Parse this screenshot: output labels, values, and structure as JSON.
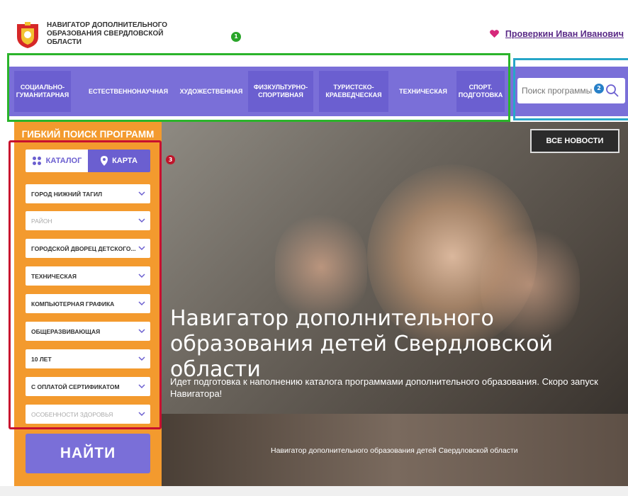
{
  "header": {
    "logo_text": "НАВИГАТОР ДОПОЛНИТЕЛЬНОГО ОБРАЗОВАНИЯ СВЕРДЛОВСКОЙ ОБЛАСТИ",
    "user_name": "Проверкин Иван Иванович",
    "markers": [
      "1",
      "2",
      "3"
    ]
  },
  "nav": {
    "items": [
      "СОЦИАЛЬНО-ГУМАНИТАРНАЯ",
      "ЕСТЕСТВЕННОНАУЧНАЯ",
      "ХУДОЖЕСТВЕННАЯ",
      "ФИЗКУЛЬТУРНО-СПОРТИВНАЯ",
      "ТУРИСТСКО-КРАЕВЕДЧЕСКАЯ",
      "ТЕХНИЧЕСКАЯ",
      "СПОРТ. ПОДГОТОВКА"
    ]
  },
  "search": {
    "placeholder": "Поиск программы"
  },
  "sidebar": {
    "title": "ГИБКИЙ ПОИСК ПРОГРАММ",
    "tabs": [
      "КАТАЛОГ",
      "КАРТА"
    ],
    "filters": [
      "ГОРОД НИЖНИЙ ТАГИЛ",
      "РАЙОН",
      "ГОРОДСКОЙ ДВОРЕЦ ДЕТСКОГО...",
      "ТЕХНИЧЕСКАЯ",
      "КОМПЬЮТЕРНАЯ ГРАФИКА",
      "ОБЩЕРАЗВИВАЮЩАЯ",
      "10 ЛЕТ",
      "С ОПЛАТОЙ СЕРТИФИКАТОМ",
      "ОСОБЕННОСТИ ЗДОРОВЬЯ"
    ],
    "find_label": "НАЙТИ"
  },
  "hero": {
    "news_button": "ВСЕ НОВОСТИ",
    "title": "Навигатор дополнительного образования детей Свердловской области",
    "subtitle": "Идет подготовка к наполнению каталога программами дополнительного образования. Скоро запуск Навигатора!",
    "caption": "Навигатор дополнительного образования детей Свердловской области"
  },
  "colors": {
    "nav_purple": "#7a6fd8",
    "sidebar_orange": "#f39a2e",
    "frame_green": "#2bb42b",
    "frame_blue": "#27a6c8",
    "frame_red": "#c8102e",
    "link_purple": "#5a2a87"
  }
}
